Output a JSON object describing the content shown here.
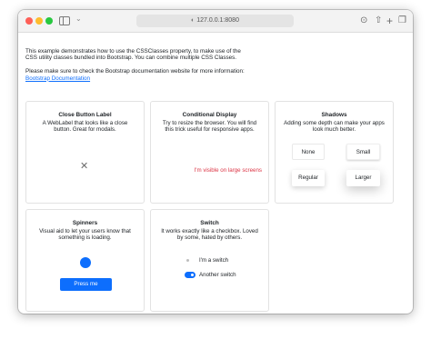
{
  "browser": {
    "url": "127.0.0.1:8080",
    "icons": {
      "close": "close-window",
      "minimize": "minimize-window",
      "maximize": "maximize-window",
      "sidebar": "sidebar-icon",
      "download": "download-icon",
      "share": "share-icon",
      "new_tab": "plus-icon",
      "tabs": "tab-overview-icon"
    },
    "colors": {
      "close": "#fe5f57",
      "minimize": "#febc2e",
      "maximize": "#28c840"
    }
  },
  "intro": {
    "paragraph1": "This example demonstrates how to use the CSSClasses property, to make use of the CSS utility classes bundled into Bootstrap. You can combine multiple CSS Classes.",
    "paragraph2": "Please make sure to check the Bootstrap documentation website for more information:",
    "link": "Bootstrap Documentation"
  },
  "cards": {
    "close_button": {
      "title": "Close Button Label",
      "text": "A WebLabel that looks like a close button. Great for modals.",
      "symbol": "✕"
    },
    "conditional": {
      "title": "Conditional Display",
      "text": "Try to resize the browser. You will find this trick useful for responsive apps.",
      "visible_text": "I'm visible on large screens"
    },
    "shadows": {
      "title": "Shadows",
      "text": "Adding some depth can make your apps look much better.",
      "buttons": [
        "None",
        "Small",
        "Regular",
        "Larger"
      ]
    },
    "spinners": {
      "title": "Spinners",
      "text": "Visual aid to let your users know that something is loading.",
      "button": "Press me"
    },
    "switch": {
      "title": "Switch",
      "text": "It works exactly like a checkbox. Loved by some, hated by others.",
      "switch1": {
        "label": "I'm a switch",
        "checked": false
      },
      "switch2": {
        "label": "Another switch",
        "checked": true
      }
    }
  },
  "colors": {
    "primary": "#0d6efd",
    "danger": "#dc3545"
  }
}
